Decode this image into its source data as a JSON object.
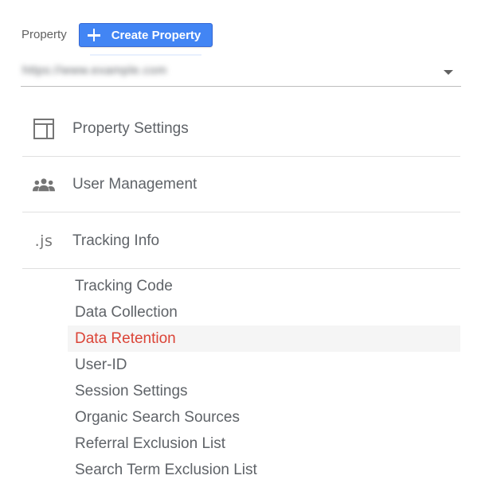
{
  "header": {
    "property_label": "Property",
    "create_button_label": "Create Property"
  },
  "property_select": {
    "value": "https://www.example.com",
    "value_blurred": true
  },
  "nav": {
    "items": [
      {
        "label": "Property Settings",
        "icon": "layout-icon"
      },
      {
        "label": "User Management",
        "icon": "people-icon"
      },
      {
        "label": "Tracking Info",
        "icon": "js-icon",
        "icon_text": ".js"
      }
    ]
  },
  "tracking_sub": {
    "active_index": 2,
    "items": [
      {
        "label": "Tracking Code"
      },
      {
        "label": "Data Collection"
      },
      {
        "label": "Data Retention"
      },
      {
        "label": "User-ID"
      },
      {
        "label": "Session Settings"
      },
      {
        "label": "Organic Search Sources"
      },
      {
        "label": "Referral Exclusion List"
      },
      {
        "label": "Search Term Exclusion List"
      }
    ]
  },
  "colors": {
    "accent_button": "#4285f4",
    "active_item_text": "#db4437",
    "active_item_bg": "#f5f5f5",
    "text": "#5f6368",
    "divider": "#e0e0e0"
  }
}
